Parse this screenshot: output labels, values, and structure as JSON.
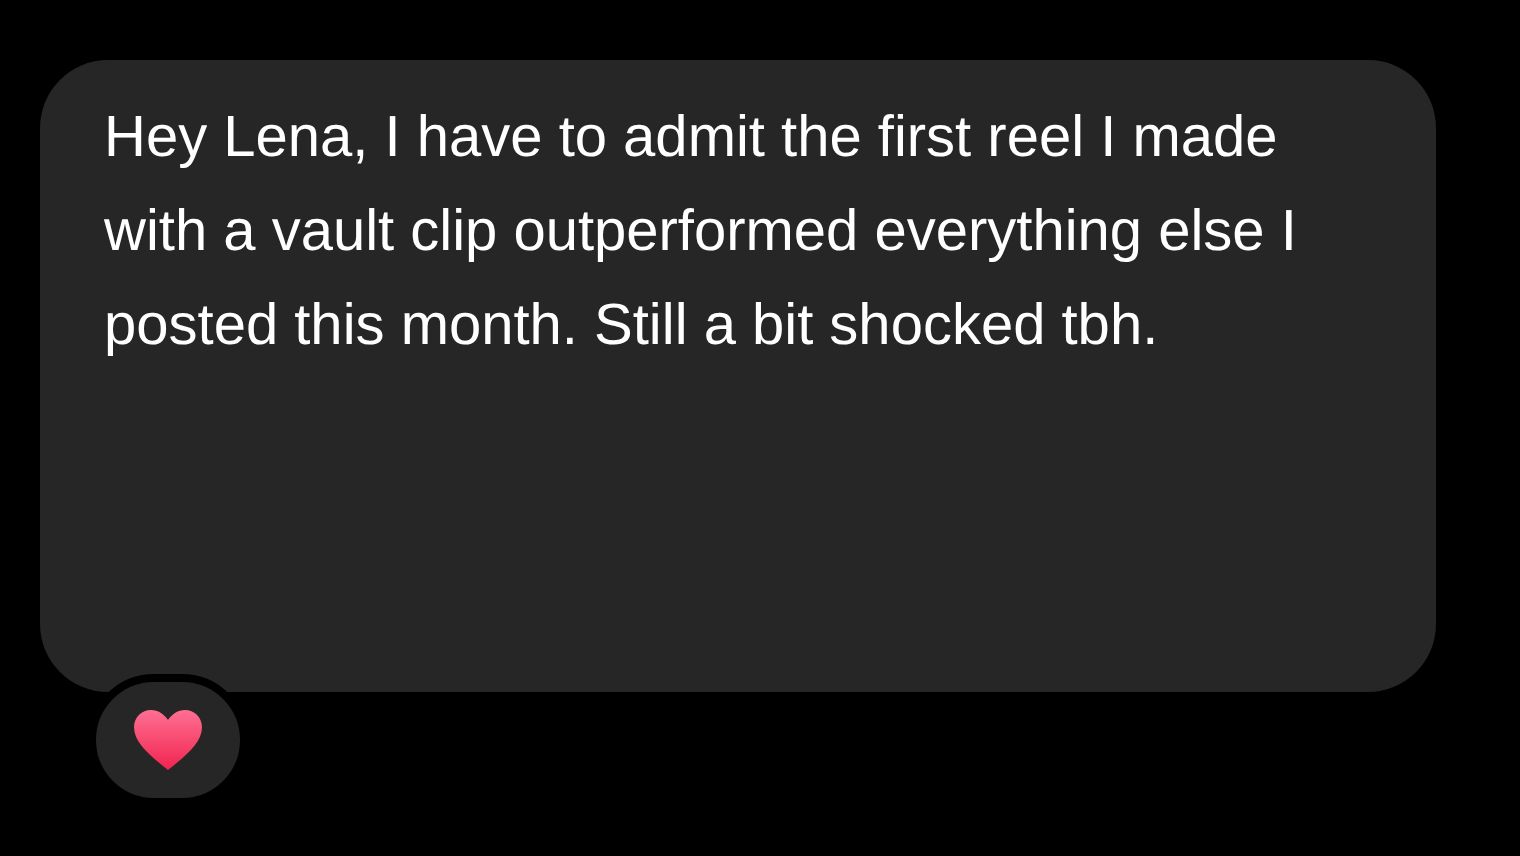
{
  "message": {
    "text": "Hey Lena, I have to admit the first reel I made with a vault clip outperformed everything else I posted this month. Still a bit shocked tbh."
  },
  "reaction": {
    "kind": "heart"
  }
}
